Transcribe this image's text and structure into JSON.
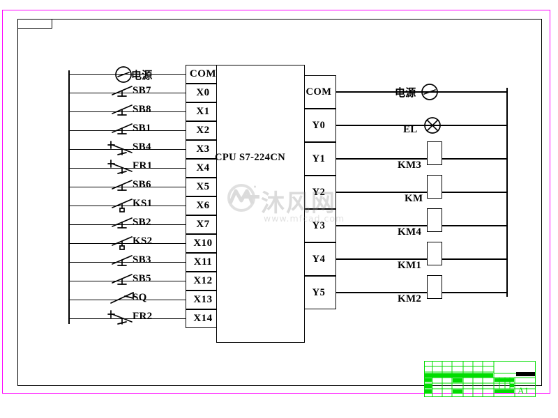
{
  "drawing": {
    "title_code": "A1",
    "cpu_label": "CPU  S7-224CN",
    "power_label_left": "电源",
    "power_label_right": "电源",
    "watermark_text": "沐风网",
    "watermark_url": "www.mfcad.com",
    "frame_color": "#000000",
    "border_color": "#ff00ff",
    "titleblock_color": "#00dd00"
  },
  "inputs": {
    "terminals": [
      {
        "id": "COM",
        "device": "",
        "contact": ""
      },
      {
        "id": "X0",
        "device": "SB7",
        "contact": "no"
      },
      {
        "id": "X1",
        "device": "SB8",
        "contact": "no"
      },
      {
        "id": "X2",
        "device": "SB1",
        "contact": "no"
      },
      {
        "id": "X3",
        "device": "SB4",
        "contact": "nc"
      },
      {
        "id": "X4",
        "device": "FR1",
        "contact": "nc"
      },
      {
        "id": "X5",
        "device": "SB6",
        "contact": "no"
      },
      {
        "id": "X6",
        "device": "KS1",
        "contact": "ks"
      },
      {
        "id": "X7",
        "device": "SB2",
        "contact": "no"
      },
      {
        "id": "X10",
        "device": "KS2",
        "contact": "ks"
      },
      {
        "id": "X11",
        "device": "SB3",
        "contact": "no"
      },
      {
        "id": "X12",
        "device": "SB5",
        "contact": "no"
      },
      {
        "id": "X13",
        "device": "SQ",
        "contact": "lim"
      },
      {
        "id": "X14",
        "device": "FR2",
        "contact": "nc"
      }
    ]
  },
  "outputs": {
    "terminals": [
      {
        "id": "COM",
        "device": "电源",
        "symbol": "source"
      },
      {
        "id": "Y0",
        "device": "EL",
        "symbol": "lamp"
      },
      {
        "id": "Y1",
        "device": "KM3",
        "symbol": "coil"
      },
      {
        "id": "Y2",
        "device": "KM",
        "symbol": "coil"
      },
      {
        "id": "Y3",
        "device": "KM4",
        "symbol": "coil"
      },
      {
        "id": "Y4",
        "device": "KM1",
        "symbol": "coil"
      },
      {
        "id": "Y5",
        "device": "KM2",
        "symbol": "coil"
      }
    ]
  }
}
